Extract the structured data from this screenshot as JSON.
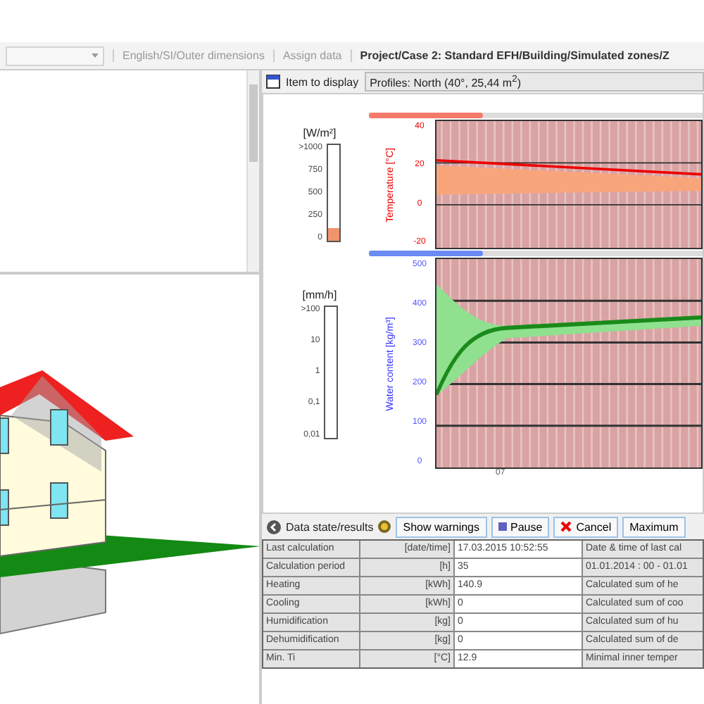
{
  "toolbar": {
    "items": [
      {
        "kind": "dropdown"
      },
      {
        "kind": "link",
        "label": "English/SI/Outer dimensions"
      },
      {
        "kind": "link",
        "label": "Assign data"
      },
      {
        "kind": "path",
        "label": "Project/Case 2: Standard EFH/Building/Simulated zones/Z"
      }
    ]
  },
  "display": {
    "label": "Item to display",
    "value": "Profiles: North (40°, 25,44 m$^{2}$)"
  },
  "radiation_scale": {
    "unit": "[W/m²]",
    "ticks": [
      ">1000",
      "750",
      "500",
      "250",
      "0"
    ],
    "level": 0.13
  },
  "temperature_chart": {
    "slider": {
      "level": 0.34
    },
    "ylabel": "Temperature [°C]",
    "yticks": [
      "40",
      "20",
      "0",
      "-20"
    ]
  },
  "rain_scale": {
    "unit": "[mm/h]",
    "ticks": [
      ">100",
      "10",
      "1",
      "0,1",
      "0,01"
    ]
  },
  "water_chart": {
    "slider": {
      "level": 0.34
    },
    "ylabel": "Water content [kg/m³]",
    "yticks": [
      "500",
      "400",
      "300",
      "200",
      "100",
      "0"
    ],
    "xtick": "07"
  },
  "results_toolbar": {
    "status": "Data state/results",
    "buttons": [
      {
        "kind": "plain",
        "label": "Show warnings"
      },
      {
        "kind": "pause",
        "label": "Pause"
      },
      {
        "kind": "cancel",
        "label": "Cancel"
      },
      {
        "kind": "plain",
        "label": "Maximum"
      }
    ]
  },
  "table": {
    "rows": [
      {
        "name": "Last calculation",
        "unit": "[date/time]",
        "value": "17.03.2015 10:52:55",
        "description": "Date & time of last cal"
      },
      {
        "name": "Calculation period",
        "unit": "[h]",
        "value": "35",
        "description": "01.01.2014 : 00 - 01.01"
      },
      {
        "name": "Heating",
        "unit": "[kWh]",
        "value": "140.9",
        "description": "Calculated sum of he"
      },
      {
        "name": "Cooling",
        "unit": "[kWh]",
        "value": "0",
        "description": "Calculated sum of coo"
      },
      {
        "name": "Humidification",
        "unit": "[kg]",
        "value": "0",
        "description": "Calculated sum of hu"
      },
      {
        "name": "Dehumidification",
        "unit": "[kg]",
        "value": "0",
        "description": "Calculated sum of de"
      },
      {
        "name": "Min. Ti",
        "unit": "[°C]",
        "value": "12.9",
        "description": "Minimal inner temper"
      }
    ]
  }
}
